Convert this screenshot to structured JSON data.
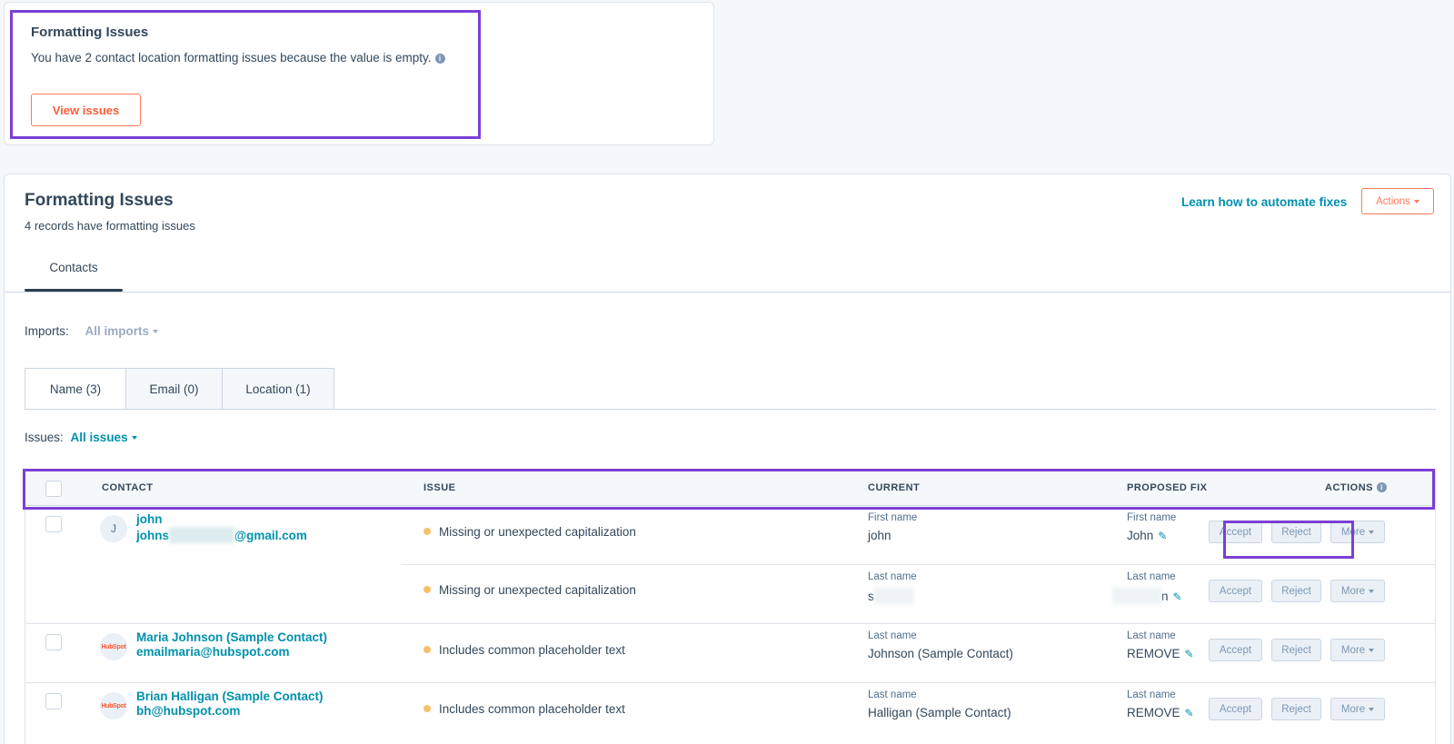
{
  "top_card": {
    "title": "Formatting Issues",
    "description": "You have 2 contact location formatting issues because the value is empty.",
    "button": "View issues"
  },
  "main": {
    "title": "Formatting Issues",
    "subtitle": "4 records have formatting issues",
    "learn_link": "Learn how to automate fixes",
    "actions_button": "Actions",
    "tab": "Contacts",
    "imports_label": "Imports:",
    "imports_value": "All imports",
    "subtabs": [
      "Name (3)",
      "Email (0)",
      "Location (1)"
    ],
    "issues_label": "Issues:",
    "issues_value": "All issues"
  },
  "table": {
    "headers": {
      "contact": "CONTACT",
      "issue": "ISSUE",
      "current": "CURRENT",
      "proposed": "PROPOSED FIX",
      "actions": "ACTIONS"
    },
    "buttons": {
      "accept": "Accept",
      "reject": "Reject",
      "more": "More"
    },
    "rows": [
      {
        "avatar": "J",
        "name": "john",
        "email_prefix": "johns",
        "email_suffix": "@gmail.com",
        "issues": [
          {
            "issue": "Missing or unexpected capitalization",
            "current_label": "First name",
            "current_value": "john",
            "fix_label": "First name",
            "fix_value": "John"
          },
          {
            "issue": "Missing or unexpected capitalization",
            "current_label": "Last name",
            "current_value": "s",
            "fix_label": "Last name",
            "fix_value": "n"
          }
        ]
      },
      {
        "avatar": "HubSpot",
        "name": "Maria Johnson (Sample Contact)",
        "email": "emailmaria@hubspot.com",
        "issues": [
          {
            "issue": "Includes common placeholder text",
            "current_label": "Last name",
            "current_value": "Johnson (Sample Contact)",
            "fix_label": "Last name",
            "fix_value": "REMOVE"
          }
        ]
      },
      {
        "avatar": "HubSpot",
        "name": "Brian Halligan (Sample Contact)",
        "email": "bh@hubspot.com",
        "issues": [
          {
            "issue": "Includes common placeholder text",
            "current_label": "Last name",
            "current_value": "Halligan (Sample Contact)",
            "fix_label": "Last name",
            "fix_value": "REMOVE"
          }
        ]
      }
    ]
  },
  "colors": {
    "highlight": "#7b3fd4",
    "link": "#0091ae",
    "accent": "#ff7a59",
    "status_dot": "#f5c26b"
  }
}
